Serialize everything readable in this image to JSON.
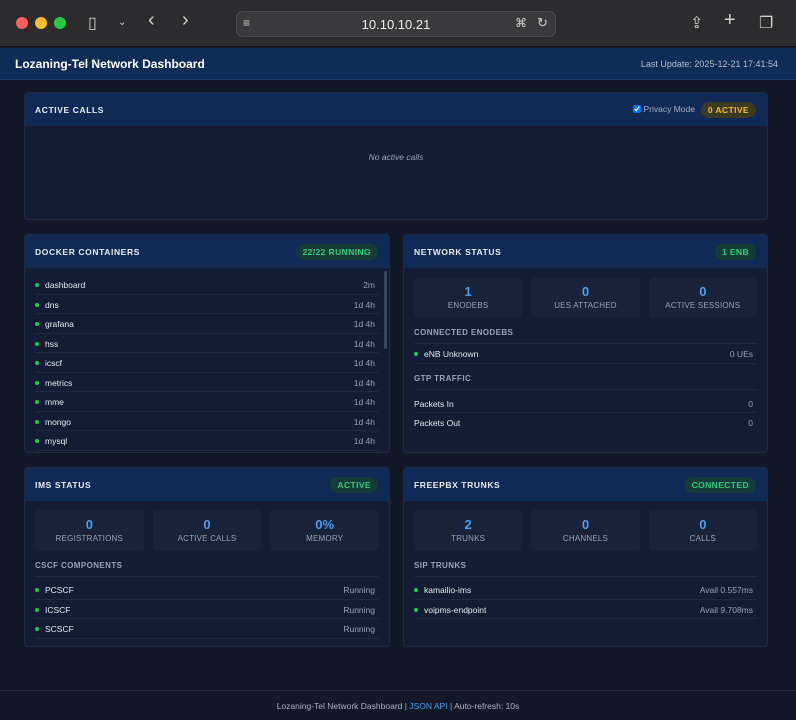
{
  "browser": {
    "url": "10.10.10.21"
  },
  "header": {
    "title": "Lozaning-Tel Network Dashboard",
    "last_update": "Last Update: 2025-12-21 17:41:54"
  },
  "active_calls": {
    "title": "ACTIVE CALLS",
    "privacy_label": "Privacy Mode",
    "privacy_checked": true,
    "badge": "0 ACTIVE",
    "empty": "No active calls"
  },
  "docker": {
    "title": "DOCKER CONTAINERS",
    "badge": "22/22 RUNNING",
    "items": [
      {
        "name": "dashboard",
        "uptime": "2m"
      },
      {
        "name": "dns",
        "uptime": "1d 4h"
      },
      {
        "name": "grafana",
        "uptime": "1d 4h"
      },
      {
        "name": "hss",
        "uptime": "1d 4h"
      },
      {
        "name": "icscf",
        "uptime": "1d 4h"
      },
      {
        "name": "metrics",
        "uptime": "1d 4h"
      },
      {
        "name": "mme",
        "uptime": "1d 4h"
      },
      {
        "name": "mongo",
        "uptime": "1d 4h"
      },
      {
        "name": "mysql",
        "uptime": "1d 4h"
      }
    ]
  },
  "network": {
    "title": "NETWORK STATUS",
    "badge": "1 ENB",
    "stats": [
      {
        "value": "1",
        "label": "ENODEBS"
      },
      {
        "value": "0",
        "label": "UES ATTACHED"
      },
      {
        "value": "0",
        "label": "ACTIVE SESSIONS"
      }
    ],
    "enb_section": "CONNECTED ENODEBS",
    "enbs": [
      {
        "name": "eNB Unknown",
        "value": "0 UEs"
      }
    ],
    "gtp_section": "GTP TRAFFIC",
    "gtp": [
      {
        "name": "Packets In",
        "value": "0"
      },
      {
        "name": "Packets Out",
        "value": "0"
      }
    ]
  },
  "ims": {
    "title": "IMS STATUS",
    "badge": "ACTIVE",
    "stats": [
      {
        "value": "0",
        "label": "REGISTRATIONS"
      },
      {
        "value": "0",
        "label": "ACTIVE CALLS"
      },
      {
        "value": "0%",
        "label": "MEMORY"
      }
    ],
    "section": "CSCF COMPONENTS",
    "items": [
      {
        "name": "PCSCF",
        "status": "Running"
      },
      {
        "name": "ICSCF",
        "status": "Running"
      },
      {
        "name": "SCSCF",
        "status": "Running"
      }
    ]
  },
  "freepbx": {
    "title": "FREEPBX TRUNKS",
    "badge": "CONNECTED",
    "stats": [
      {
        "value": "2",
        "label": "TRUNKS"
      },
      {
        "value": "0",
        "label": "CHANNELS"
      },
      {
        "value": "0",
        "label": "CALLS"
      }
    ],
    "section": "SIP TRUNKS",
    "items": [
      {
        "name": "kamailio-ims",
        "status": "Avail 0.557ms"
      },
      {
        "name": "voipms-endpoint",
        "status": "Avail 9.708ms"
      }
    ]
  },
  "footer": {
    "text1": "Lozaning-Tel Network Dashboard |",
    "link": "JSON API",
    "text2": "| Auto-refresh: 10s"
  },
  "colors": {
    "accent": "#4a9ff0",
    "ok": "#22c55e",
    "header": "#0f2b57",
    "warn": "#f0c030"
  }
}
